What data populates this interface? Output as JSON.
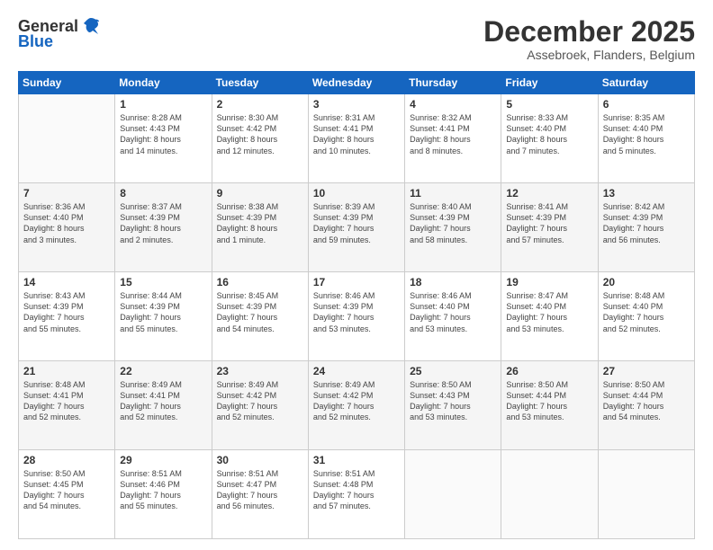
{
  "header": {
    "logo": {
      "line1": "General",
      "line2": "Blue"
    },
    "title": "December 2025",
    "location": "Assebroek, Flanders, Belgium"
  },
  "days_of_week": [
    "Sunday",
    "Monday",
    "Tuesday",
    "Wednesday",
    "Thursday",
    "Friday",
    "Saturday"
  ],
  "weeks": [
    [
      {
        "day": "",
        "info": ""
      },
      {
        "day": "1",
        "info": "Sunrise: 8:28 AM\nSunset: 4:43 PM\nDaylight: 8 hours\nand 14 minutes."
      },
      {
        "day": "2",
        "info": "Sunrise: 8:30 AM\nSunset: 4:42 PM\nDaylight: 8 hours\nand 12 minutes."
      },
      {
        "day": "3",
        "info": "Sunrise: 8:31 AM\nSunset: 4:41 PM\nDaylight: 8 hours\nand 10 minutes."
      },
      {
        "day": "4",
        "info": "Sunrise: 8:32 AM\nSunset: 4:41 PM\nDaylight: 8 hours\nand 8 minutes."
      },
      {
        "day": "5",
        "info": "Sunrise: 8:33 AM\nSunset: 4:40 PM\nDaylight: 8 hours\nand 7 minutes."
      },
      {
        "day": "6",
        "info": "Sunrise: 8:35 AM\nSunset: 4:40 PM\nDaylight: 8 hours\nand 5 minutes."
      }
    ],
    [
      {
        "day": "7",
        "info": "Sunrise: 8:36 AM\nSunset: 4:40 PM\nDaylight: 8 hours\nand 3 minutes."
      },
      {
        "day": "8",
        "info": "Sunrise: 8:37 AM\nSunset: 4:39 PM\nDaylight: 8 hours\nand 2 minutes."
      },
      {
        "day": "9",
        "info": "Sunrise: 8:38 AM\nSunset: 4:39 PM\nDaylight: 8 hours\nand 1 minute."
      },
      {
        "day": "10",
        "info": "Sunrise: 8:39 AM\nSunset: 4:39 PM\nDaylight: 7 hours\nand 59 minutes."
      },
      {
        "day": "11",
        "info": "Sunrise: 8:40 AM\nSunset: 4:39 PM\nDaylight: 7 hours\nand 58 minutes."
      },
      {
        "day": "12",
        "info": "Sunrise: 8:41 AM\nSunset: 4:39 PM\nDaylight: 7 hours\nand 57 minutes."
      },
      {
        "day": "13",
        "info": "Sunrise: 8:42 AM\nSunset: 4:39 PM\nDaylight: 7 hours\nand 56 minutes."
      }
    ],
    [
      {
        "day": "14",
        "info": "Sunrise: 8:43 AM\nSunset: 4:39 PM\nDaylight: 7 hours\nand 55 minutes."
      },
      {
        "day": "15",
        "info": "Sunrise: 8:44 AM\nSunset: 4:39 PM\nDaylight: 7 hours\nand 55 minutes."
      },
      {
        "day": "16",
        "info": "Sunrise: 8:45 AM\nSunset: 4:39 PM\nDaylight: 7 hours\nand 54 minutes."
      },
      {
        "day": "17",
        "info": "Sunrise: 8:46 AM\nSunset: 4:39 PM\nDaylight: 7 hours\nand 53 minutes."
      },
      {
        "day": "18",
        "info": "Sunrise: 8:46 AM\nSunset: 4:40 PM\nDaylight: 7 hours\nand 53 minutes."
      },
      {
        "day": "19",
        "info": "Sunrise: 8:47 AM\nSunset: 4:40 PM\nDaylight: 7 hours\nand 53 minutes."
      },
      {
        "day": "20",
        "info": "Sunrise: 8:48 AM\nSunset: 4:40 PM\nDaylight: 7 hours\nand 52 minutes."
      }
    ],
    [
      {
        "day": "21",
        "info": "Sunrise: 8:48 AM\nSunset: 4:41 PM\nDaylight: 7 hours\nand 52 minutes."
      },
      {
        "day": "22",
        "info": "Sunrise: 8:49 AM\nSunset: 4:41 PM\nDaylight: 7 hours\nand 52 minutes."
      },
      {
        "day": "23",
        "info": "Sunrise: 8:49 AM\nSunset: 4:42 PM\nDaylight: 7 hours\nand 52 minutes."
      },
      {
        "day": "24",
        "info": "Sunrise: 8:49 AM\nSunset: 4:42 PM\nDaylight: 7 hours\nand 52 minutes."
      },
      {
        "day": "25",
        "info": "Sunrise: 8:50 AM\nSunset: 4:43 PM\nDaylight: 7 hours\nand 53 minutes."
      },
      {
        "day": "26",
        "info": "Sunrise: 8:50 AM\nSunset: 4:44 PM\nDaylight: 7 hours\nand 53 minutes."
      },
      {
        "day": "27",
        "info": "Sunrise: 8:50 AM\nSunset: 4:44 PM\nDaylight: 7 hours\nand 54 minutes."
      }
    ],
    [
      {
        "day": "28",
        "info": "Sunrise: 8:50 AM\nSunset: 4:45 PM\nDaylight: 7 hours\nand 54 minutes."
      },
      {
        "day": "29",
        "info": "Sunrise: 8:51 AM\nSunset: 4:46 PM\nDaylight: 7 hours\nand 55 minutes."
      },
      {
        "day": "30",
        "info": "Sunrise: 8:51 AM\nSunset: 4:47 PM\nDaylight: 7 hours\nand 56 minutes."
      },
      {
        "day": "31",
        "info": "Sunrise: 8:51 AM\nSunset: 4:48 PM\nDaylight: 7 hours\nand 57 minutes."
      },
      {
        "day": "",
        "info": ""
      },
      {
        "day": "",
        "info": ""
      },
      {
        "day": "",
        "info": ""
      }
    ]
  ]
}
